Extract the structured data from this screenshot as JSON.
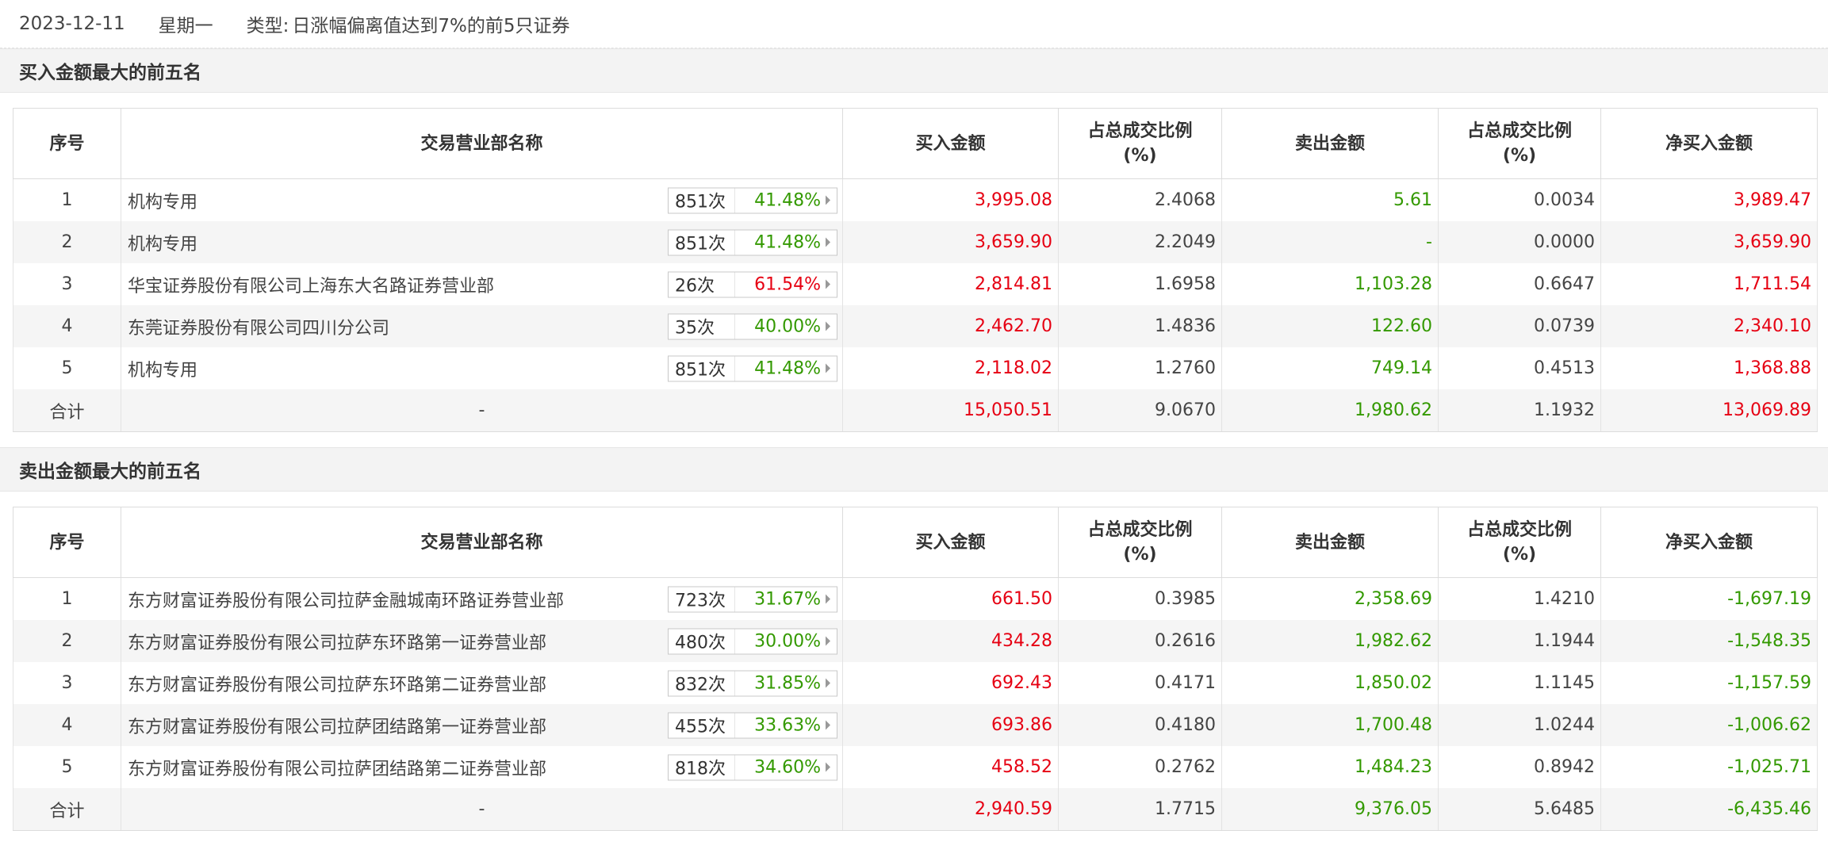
{
  "top": {
    "date": "2023-12-11",
    "weekday": "星期一",
    "type_label": "类型:",
    "type_value": "日涨幅偏离值达到7%的前5只证券"
  },
  "headers": {
    "idx": "序号",
    "name": "交易营业部名称",
    "buy": "买入金额",
    "ratio": "占总成交比例",
    "ratio_unit": "(%)",
    "sell": "卖出金额",
    "net": "净买入金额"
  },
  "buy_table": {
    "title": "买入金额最大的前五名",
    "rows": [
      {
        "idx": "1",
        "name": "机构专用",
        "count": "851次",
        "pct": "41.48%",
        "pct_color": "green",
        "buy": "3,995.08",
        "buy_ratio": "2.4068",
        "sell": "5.61",
        "sell_ratio": "0.0034",
        "net": "3,989.47",
        "net_color": "red"
      },
      {
        "idx": "2",
        "name": "机构专用",
        "count": "851次",
        "pct": "41.48%",
        "pct_color": "green",
        "buy": "3,659.90",
        "buy_ratio": "2.2049",
        "sell": "-",
        "sell_ratio": "0.0000",
        "net": "3,659.90",
        "net_color": "red"
      },
      {
        "idx": "3",
        "name": "华宝证券股份有限公司上海东大名路证券营业部",
        "count": "26次",
        "pct": "61.54%",
        "pct_color": "red",
        "buy": "2,814.81",
        "buy_ratio": "1.6958",
        "sell": "1,103.28",
        "sell_ratio": "0.6647",
        "net": "1,711.54",
        "net_color": "red"
      },
      {
        "idx": "4",
        "name": "东莞证券股份有限公司四川分公司",
        "count": "35次",
        "pct": "40.00%",
        "pct_color": "green",
        "buy": "2,462.70",
        "buy_ratio": "1.4836",
        "sell": "122.60",
        "sell_ratio": "0.0739",
        "net": "2,340.10",
        "net_color": "red"
      },
      {
        "idx": "5",
        "name": "机构专用",
        "count": "851次",
        "pct": "41.48%",
        "pct_color": "green",
        "buy": "2,118.02",
        "buy_ratio": "1.2760",
        "sell": "749.14",
        "sell_ratio": "0.4513",
        "net": "1,368.88",
        "net_color": "red"
      }
    ],
    "total": {
      "label": "合计",
      "name": "-",
      "buy": "15,050.51",
      "buy_ratio": "9.0670",
      "sell": "1,980.62",
      "sell_ratio": "1.1932",
      "net": "13,069.89",
      "net_color": "red"
    }
  },
  "sell_table": {
    "title": "卖出金额最大的前五名",
    "rows": [
      {
        "idx": "1",
        "name": "东方财富证券股份有限公司拉萨金融城南环路证券营业部",
        "count": "723次",
        "pct": "31.67%",
        "pct_color": "green",
        "buy": "661.50",
        "buy_ratio": "0.3985",
        "sell": "2,358.69",
        "sell_ratio": "1.4210",
        "net": "-1,697.19",
        "net_color": "green"
      },
      {
        "idx": "2",
        "name": "东方财富证券股份有限公司拉萨东环路第一证券营业部",
        "count": "480次",
        "pct": "30.00%",
        "pct_color": "green",
        "buy": "434.28",
        "buy_ratio": "0.2616",
        "sell": "1,982.62",
        "sell_ratio": "1.1944",
        "net": "-1,548.35",
        "net_color": "green"
      },
      {
        "idx": "3",
        "name": "东方财富证券股份有限公司拉萨东环路第二证券营业部",
        "count": "832次",
        "pct": "31.85%",
        "pct_color": "green",
        "buy": "692.43",
        "buy_ratio": "0.4171",
        "sell": "1,850.02",
        "sell_ratio": "1.1145",
        "net": "-1,157.59",
        "net_color": "green"
      },
      {
        "idx": "4",
        "name": "东方财富证券股份有限公司拉萨团结路第一证券营业部",
        "count": "455次",
        "pct": "33.63%",
        "pct_color": "green",
        "buy": "693.86",
        "buy_ratio": "0.4180",
        "sell": "1,700.48",
        "sell_ratio": "1.0244",
        "net": "-1,006.62",
        "net_color": "green"
      },
      {
        "idx": "5",
        "name": "东方财富证券股份有限公司拉萨团结路第二证券营业部",
        "count": "818次",
        "pct": "34.60%",
        "pct_color": "green",
        "buy": "458.52",
        "buy_ratio": "0.2762",
        "sell": "1,484.23",
        "sell_ratio": "0.8942",
        "net": "-1,025.71",
        "net_color": "green"
      }
    ],
    "total": {
      "label": "合计",
      "name": "-",
      "buy": "2,940.59",
      "buy_ratio": "1.7715",
      "sell": "9,376.05",
      "sell_ratio": "5.6485",
      "net": "-6,435.46",
      "net_color": "green"
    }
  },
  "colors": {
    "red": "#e60012",
    "green": "#339900"
  }
}
